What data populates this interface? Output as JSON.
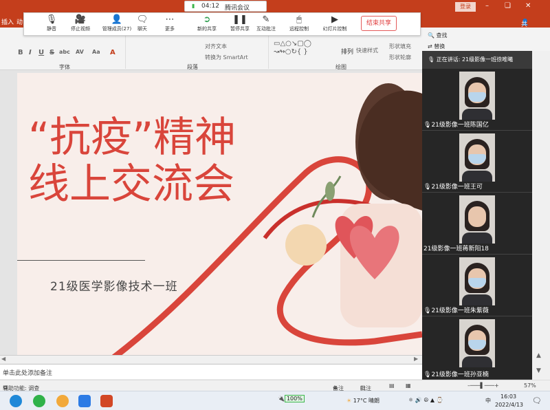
{
  "meeting": {
    "time": "04:12",
    "app_title": "腾讯会议",
    "buttons": [
      {
        "label": "静音"
      },
      {
        "label": "停止视频"
      },
      {
        "label": "管理成员(27)"
      },
      {
        "label": "聊天"
      },
      {
        "label": "更多"
      },
      {
        "label": "新的共享"
      },
      {
        "label": "暂停共享"
      },
      {
        "label": "互动批注"
      },
      {
        "label": "远程控制"
      },
      {
        "label": "幻灯片控制"
      }
    ],
    "end_share": "结束共享"
  },
  "ppt": {
    "tabs": [
      "插入",
      "动"
    ],
    "login": "登录",
    "share": "共享",
    "find": "查找",
    "replace": "替换",
    "groups": [
      "字体",
      "段落",
      "绘图"
    ],
    "ribbon_items": {
      "align_text": "对齐文本",
      "smartart": "转换为 SmartArt",
      "arrange": "排列",
      "quick_styles": "快速样式",
      "shape_fill": "形状填充",
      "shape_outline": "形状轮廓",
      "shape_effect": "形状效果"
    },
    "format_buttons": [
      "B",
      "I",
      "U",
      "S",
      "abc",
      "AV",
      "Aa",
      "A"
    ],
    "notes_placeholder": "单击此处添加备注",
    "status": {
      "accessibility": "辅助功能: 调查",
      "notes": "备注",
      "comments": "批注",
      "zoom": "57%"
    }
  },
  "slide": {
    "title_line1": "“抗疫”精神",
    "title_line2": "线上交流会",
    "subtitle": "21级医学影像技术一班"
  },
  "video_panel": {
    "speaking": "正在讲话: 21级影像一班徐唯曦",
    "participants": [
      {
        "name": "21级影像一班陈国亿"
      },
      {
        "name": "21级影像一班王可"
      },
      {
        "name": "21级影像一班蒋新阳18"
      },
      {
        "name": "21级影像一班朱紫薇"
      },
      {
        "name": "21级影像一班孙亚楠"
      }
    ]
  },
  "taskbar": {
    "battery": "100%",
    "weather": "17°C 晴朗",
    "ime": "中",
    "time": "16:03",
    "date": "2022/4/13"
  },
  "colors": {
    "ppt_red": "#c43e1c",
    "slide_title": "#d9453b",
    "end_share": "#e04040"
  }
}
